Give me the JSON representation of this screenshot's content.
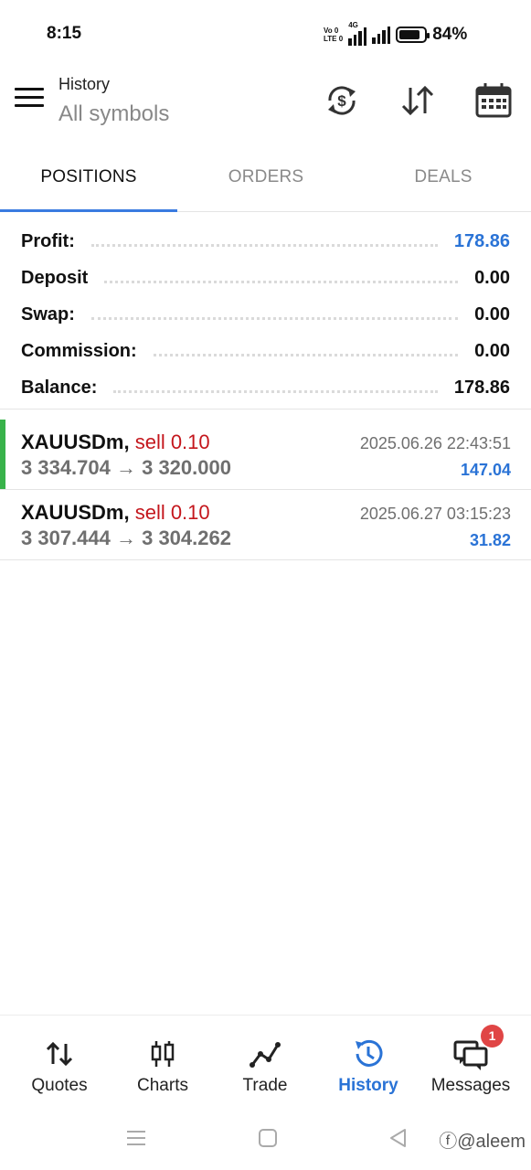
{
  "status_bar": {
    "time": "8:15",
    "volte_line1": "Vo 0",
    "volte_line2": "LTE 0",
    "network": "4G",
    "battery_percent": "84%",
    "battery_level": 0.84
  },
  "header": {
    "title": "History",
    "subtitle": "All symbols",
    "icons": [
      "menu-icon",
      "currency-refresh-icon",
      "sort-icon",
      "calendar-icon"
    ]
  },
  "tabs": [
    {
      "label": "POSITIONS",
      "active": true
    },
    {
      "label": "ORDERS",
      "active": false
    },
    {
      "label": "DEALS",
      "active": false
    }
  ],
  "summary": {
    "profit": {
      "label": "Profit:",
      "value": "178.86"
    },
    "deposit": {
      "label": "Deposit",
      "value": "0.00"
    },
    "swap": {
      "label": "Swap:",
      "value": "0.00"
    },
    "commission": {
      "label": "Commission:",
      "value": "0.00"
    },
    "balance": {
      "label": "Balance:",
      "value": "178.86"
    }
  },
  "deals": [
    {
      "symbol": "XAUUSDm,",
      "type": "sell 0.10",
      "prices": "3 334.704 → 3 320.000",
      "time": "2025.06.26 22:43:51",
      "profit": "147.04"
    },
    {
      "symbol": "XAUUSDm,",
      "type": "sell 0.10",
      "prices": "3 307.444 → 3 304.262",
      "time": "2025.06.27 03:15:23",
      "profit": "31.82"
    }
  ],
  "bottom_nav": [
    {
      "label": "Quotes",
      "icon": "quotes-arrows-icon"
    },
    {
      "label": "Charts",
      "icon": "candlestick-icon"
    },
    {
      "label": "Trade",
      "icon": "trade-line-icon"
    },
    {
      "label": "History",
      "icon": "history-clock-icon",
      "active": true
    },
    {
      "label": "Messages",
      "icon": "messages-icon",
      "badge": "1"
    }
  ],
  "watermark": "ⓕ@aleem",
  "colors": {
    "accent": "#2a73d6",
    "sell": "#c4161c",
    "position_bar": "#38b24a",
    "badge": "#e04545"
  }
}
